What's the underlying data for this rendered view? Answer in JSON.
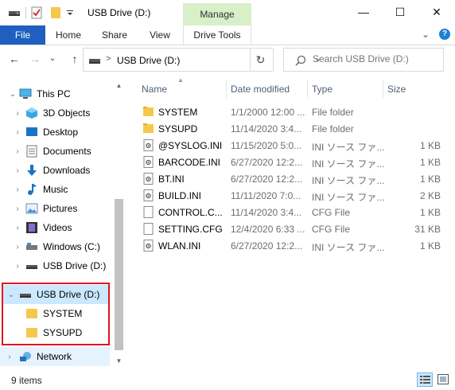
{
  "window": {
    "title": "USB Drive (D:)",
    "contextual_tab": "Manage",
    "minimize_glyph": "—",
    "maximize_glyph": "☐",
    "close_glyph": "✕"
  },
  "ribbon": {
    "tabs": [
      "File",
      "Home",
      "Share",
      "View",
      "Drive Tools"
    ],
    "collapse_glyph": "⌄",
    "help_glyph": "?"
  },
  "address": {
    "path_separator": ">",
    "path": "USB Drive (D:)",
    "dropdown_glyph": "⌄",
    "refresh_glyph": "↻",
    "back_glyph": "←",
    "forward_glyph": "→",
    "recent_glyph": "⌄",
    "up_glyph": "↑"
  },
  "search": {
    "placeholder": "Search USB Drive (D:)"
  },
  "nav": {
    "items": [
      {
        "label": "This PC",
        "icon": "computer-icon"
      },
      {
        "label": "3D Objects",
        "icon": "3d-objects-icon"
      },
      {
        "label": "Desktop",
        "icon": "desktop-icon"
      },
      {
        "label": "Documents",
        "icon": "documents-icon"
      },
      {
        "label": "Downloads",
        "icon": "downloads-icon"
      },
      {
        "label": "Music",
        "icon": "music-icon"
      },
      {
        "label": "Pictures",
        "icon": "pictures-icon"
      },
      {
        "label": "Videos",
        "icon": "videos-icon"
      },
      {
        "label": "Windows (C:)",
        "icon": "drive-icon"
      },
      {
        "label": "USB Drive (D:)",
        "icon": "usb-drive-icon"
      },
      {
        "label": "USB Drive (D:)",
        "icon": "usb-drive-icon"
      },
      {
        "label": "SYSTEM",
        "icon": "folder-icon"
      },
      {
        "label": "SYSUPD",
        "icon": "folder-icon"
      },
      {
        "label": "Network",
        "icon": "network-icon"
      }
    ]
  },
  "columns": [
    "Name",
    "Date modified",
    "Type",
    "Size"
  ],
  "files": [
    {
      "name": "SYSTEM",
      "date": "1/1/2000 12:00 ...",
      "type": "File folder",
      "size": "",
      "icon": "folder-icon"
    },
    {
      "name": "SYSUPD",
      "date": "11/14/2020 3:4...",
      "type": "File folder",
      "size": "",
      "icon": "folder-icon"
    },
    {
      "name": "@SYSLOG.INI",
      "date": "11/15/2020 5:0...",
      "type": "INI ソース ファ...",
      "size": "1 KB",
      "icon": "ini-file-icon"
    },
    {
      "name": "BARCODE.INI",
      "date": "6/27/2020 12:2...",
      "type": "INI ソース ファ...",
      "size": "1 KB",
      "icon": "ini-file-icon"
    },
    {
      "name": "BT.INI",
      "date": "6/27/2020 12:2...",
      "type": "INI ソース ファ...",
      "size": "1 KB",
      "icon": "ini-file-icon"
    },
    {
      "name": "BUILD.INI",
      "date": "11/11/2020 7:0...",
      "type": "INI ソース ファ...",
      "size": "2 KB",
      "icon": "ini-file-icon"
    },
    {
      "name": "CONTROL.C...",
      "date": "11/14/2020 3:4...",
      "type": "CFG File",
      "size": "1 KB",
      "icon": "cfg-file-icon"
    },
    {
      "name": "SETTING.CFG",
      "date": "12/4/2020 6:33 ...",
      "type": "CFG File",
      "size": "31 KB",
      "icon": "cfg-file-icon"
    },
    {
      "name": "WLAN.INI",
      "date": "6/27/2020 12:2...",
      "type": "INI ソース ファ...",
      "size": "1 KB",
      "icon": "ini-file-icon"
    }
  ],
  "status": {
    "item_count": "9 items"
  },
  "colors": {
    "accent": "#1f5fbf",
    "manage_tab": "#d8f0c8",
    "selection": "#cce8ff",
    "highlight_border": "#e0151e",
    "folder": "#f5c84c"
  }
}
